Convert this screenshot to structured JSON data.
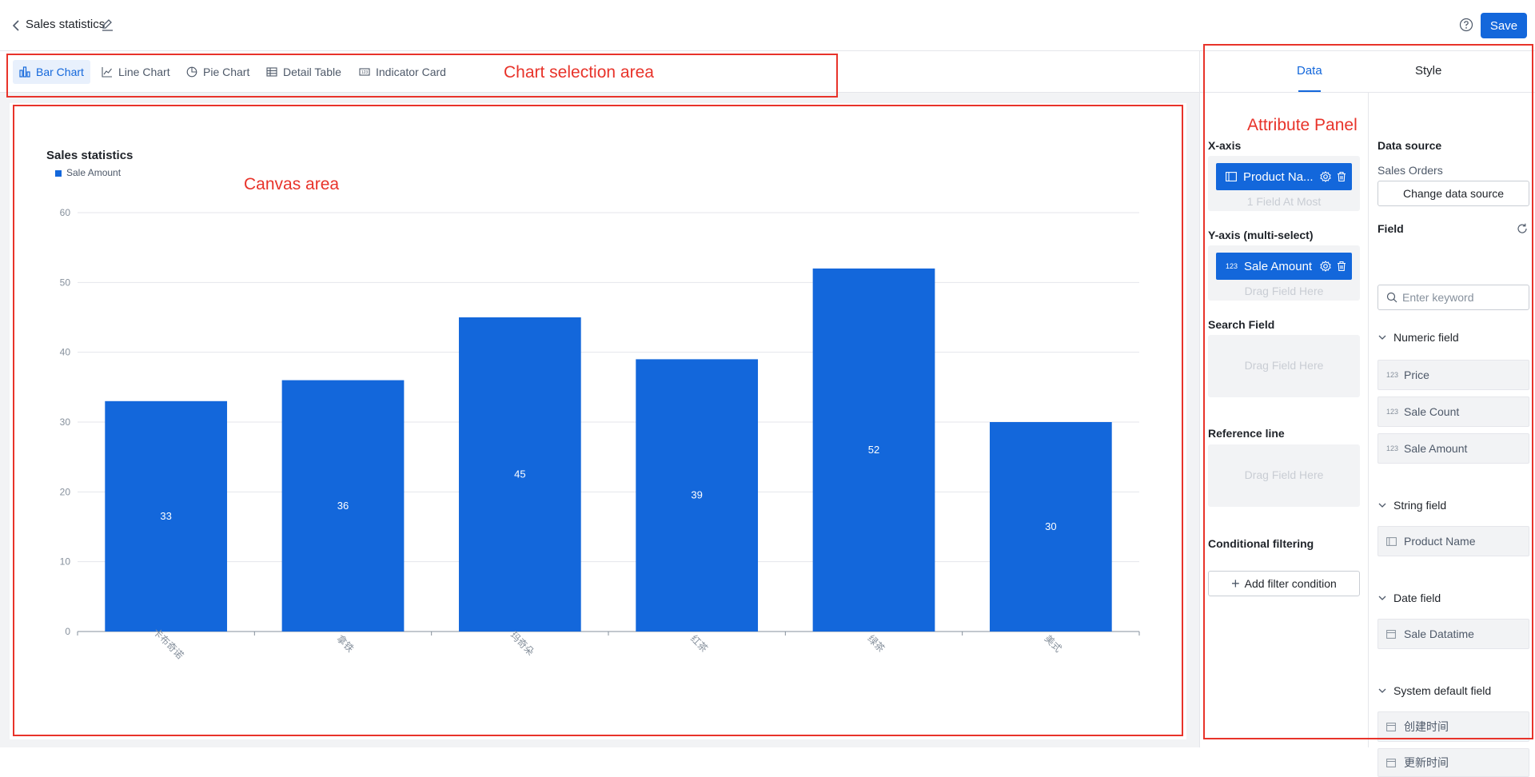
{
  "header": {
    "title": "Sales statistics",
    "save_label": "Save"
  },
  "chart_types": [
    {
      "label": "Bar Chart",
      "icon": "bar-chart-icon",
      "active": true
    },
    {
      "label": "Line Chart",
      "icon": "line-chart-icon",
      "active": false
    },
    {
      "label": "Pie Chart",
      "icon": "pie-chart-icon",
      "active": false
    },
    {
      "label": "Detail Table",
      "icon": "table-icon",
      "active": false
    },
    {
      "label": "Indicator Card",
      "icon": "indicator-card-icon",
      "active": false
    }
  ],
  "annotations": {
    "chart_selection": "Chart selection area",
    "canvas": "Canvas area",
    "attribute_panel": "Attribute  Panel"
  },
  "colors": {
    "accent": "#1367db",
    "annotation": "#e8332a"
  },
  "chart_data": {
    "type": "bar",
    "title": "Sales statistics",
    "legend": [
      "Sale Amount"
    ],
    "categories": [
      "卡布奇诺",
      "拿铁",
      "玛奇朵",
      "红茶",
      "绿茶",
      "美式"
    ],
    "series": [
      {
        "name": "Sale Amount",
        "values": [
          33,
          36,
          45,
          39,
          52,
          30
        ]
      }
    ],
    "ylim": [
      0,
      60
    ],
    "yticks": [
      0,
      10,
      20,
      30,
      40,
      50,
      60
    ],
    "grid": true,
    "data_labels": true
  },
  "panel": {
    "tabs": [
      {
        "label": "Data",
        "active": true
      },
      {
        "label": "Style",
        "active": false
      }
    ],
    "x_axis": {
      "title": "X-axis",
      "field": "Product Na...",
      "hint": "1 Field At Most"
    },
    "y_axis": {
      "title": "Y-axis (multi-select)",
      "field": "Sale Amount",
      "hint": "Drag Field Here"
    },
    "search_field": {
      "title": "Search Field",
      "hint": "Drag Field Here"
    },
    "reference_line": {
      "title": "Reference line",
      "hint": "Drag Field Here"
    },
    "conditional_filtering": {
      "title": "Conditional filtering",
      "button": "Add filter condition"
    },
    "data_source": {
      "title": "Data source",
      "value": "Sales Orders",
      "button": "Change data source"
    },
    "field": {
      "title": "Field",
      "search_placeholder": "Enter keyword",
      "groups": {
        "numeric": {
          "title": "Numeric field",
          "items": [
            "Price",
            "Sale Count",
            "Sale Amount"
          ]
        },
        "string": {
          "title": "String field",
          "items": [
            "Product Name"
          ]
        },
        "date": {
          "title": "Date field",
          "items": [
            "Sale Datatime"
          ]
        },
        "system": {
          "title": "System default field",
          "items": [
            "创建时间",
            "更新时间"
          ]
        }
      }
    }
  }
}
